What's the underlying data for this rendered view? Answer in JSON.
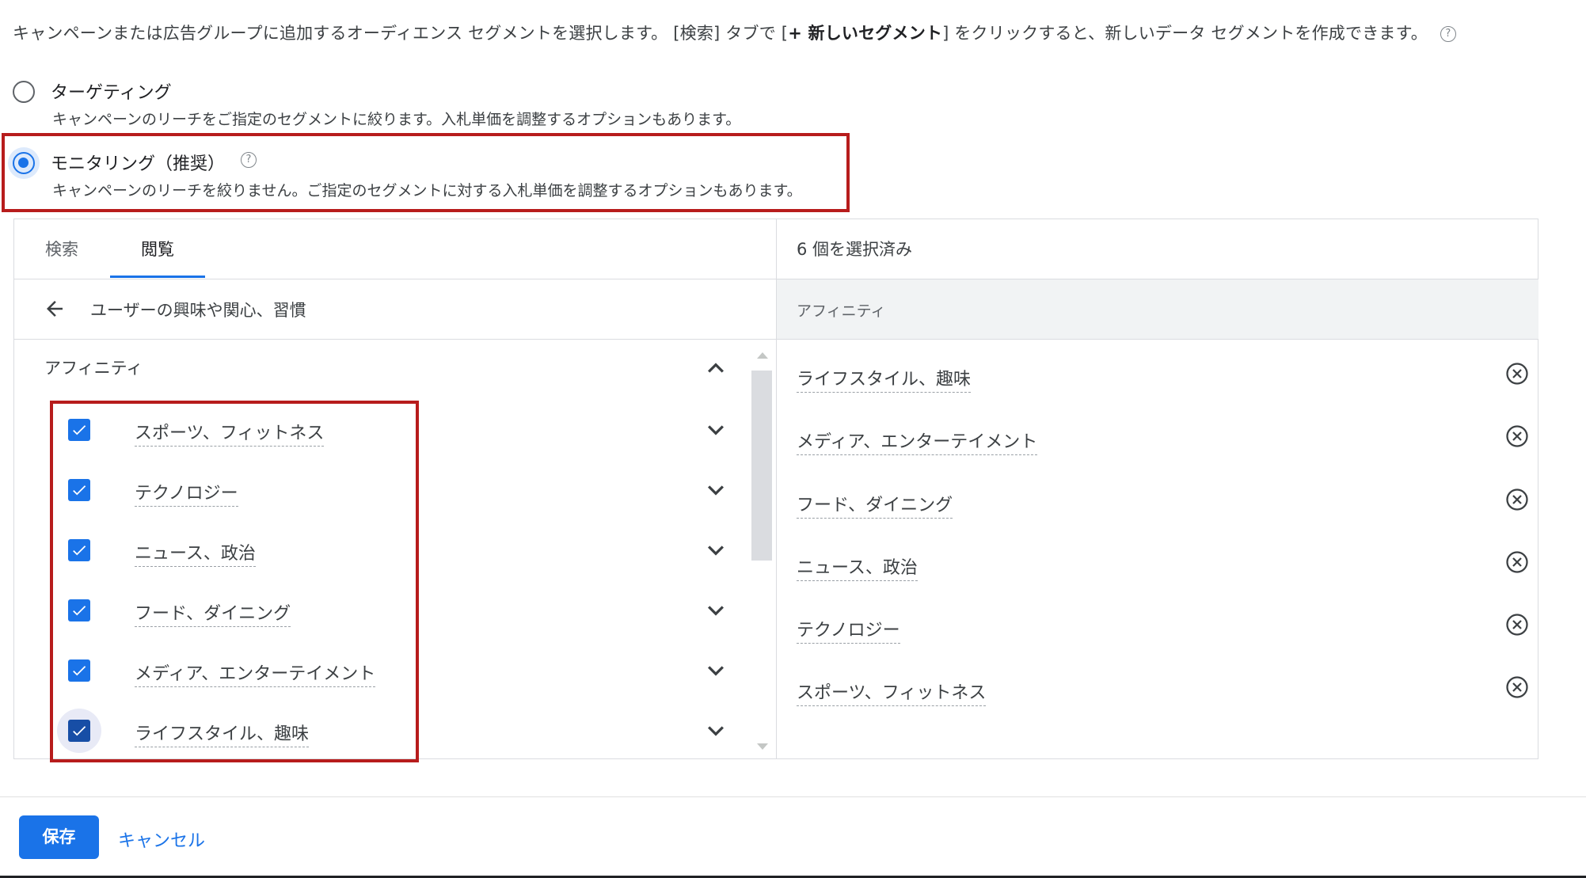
{
  "intro": {
    "text_before": "キャンペーンまたは広告グループに追加するオーディエンス セグメントを選択します。 [検索] タブで [",
    "text_bold": "+ 新しいセグメント",
    "text_after": "] をクリックすると、新しいデータ セグメントを作成できます。",
    "help_icon": "?"
  },
  "options": [
    {
      "title": "ターゲティング",
      "description": "キャンペーンのリーチをご指定のセグメントに絞ります。入札単価を調整するオプションもあります。",
      "selected": false
    },
    {
      "title": "モニタリング（推奨）",
      "description": "キャンペーンのリーチを絞りません。ご指定のセグメントに対する入札単価を調整するオプションもあります。",
      "selected": true,
      "help_icon": "?"
    }
  ],
  "tabs": [
    {
      "label": "検索",
      "active": false
    },
    {
      "label": "閲覧",
      "active": true
    }
  ],
  "browse": {
    "back_label": "ユーザーの興味や関心、習慣",
    "category": "アフィニティ",
    "items": [
      {
        "label": "スポーツ、フィットネス",
        "checked": true
      },
      {
        "label": "テクノロジー",
        "checked": true
      },
      {
        "label": "ニュース、政治",
        "checked": true
      },
      {
        "label": "フード、ダイニング",
        "checked": true
      },
      {
        "label": "メディア、エンターテイメント",
        "checked": true
      },
      {
        "label": "ライフスタイル、趣味",
        "checked": true
      }
    ]
  },
  "selected_panel": {
    "header": "6 個を選択済み",
    "group": "アフィニティ",
    "items": [
      "ライフスタイル、趣味",
      "メディア、エンターテイメント",
      "フード、ダイニング",
      "ニュース、政治",
      "テクノロジー",
      "スポーツ、フィットネス"
    ]
  },
  "footer": {
    "save_label": "保存",
    "cancel_label": "キャンセル"
  },
  "colors": {
    "accent": "#1a73e8",
    "highlight_border": "#b71c1c"
  }
}
